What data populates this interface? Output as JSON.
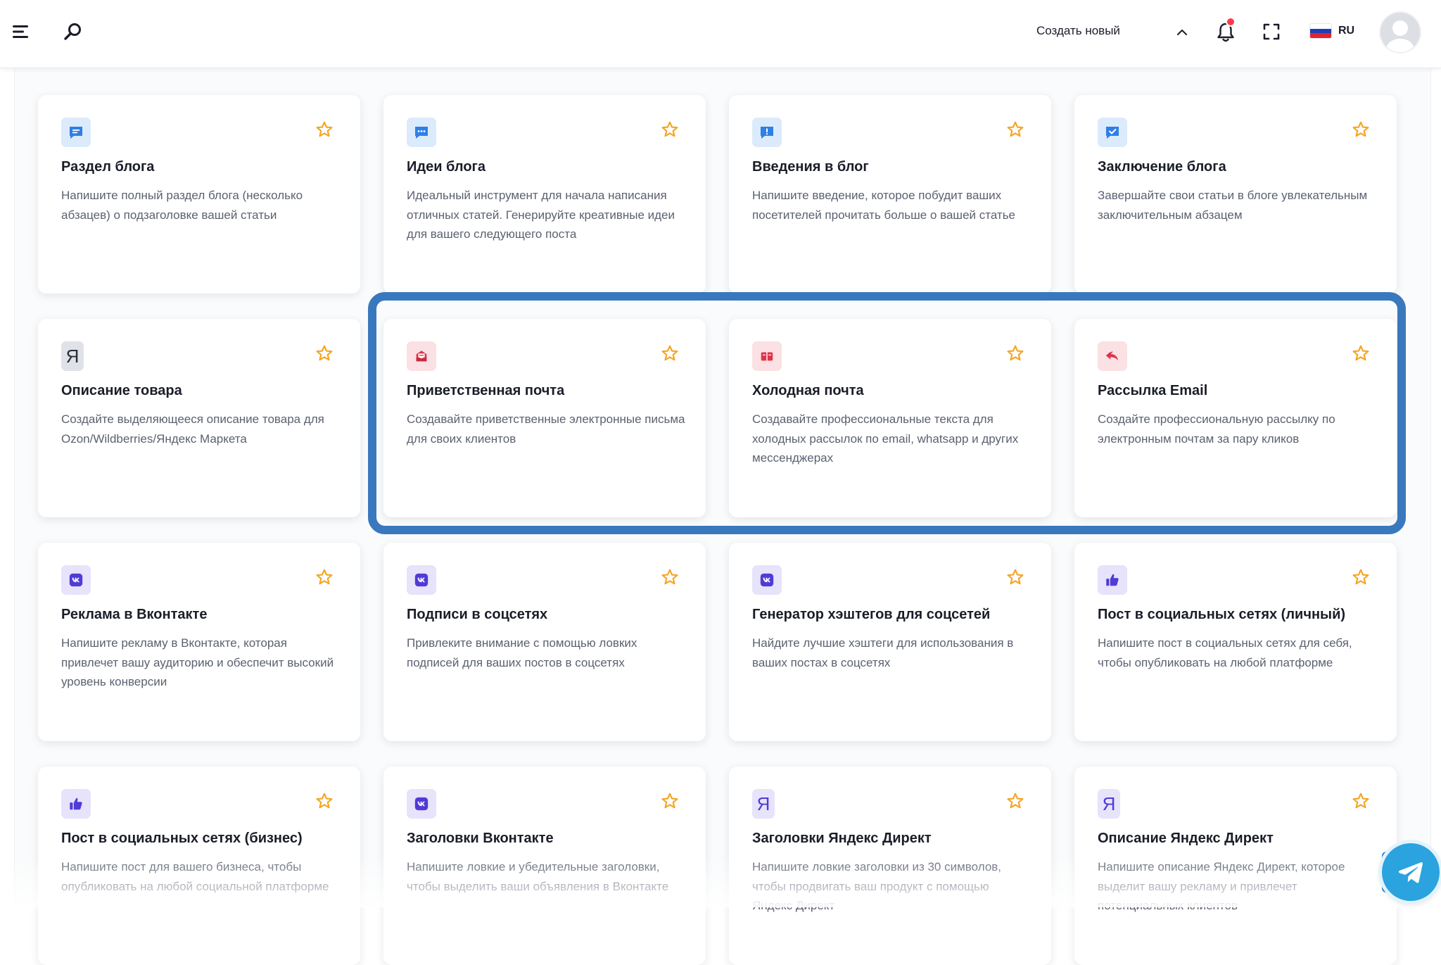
{
  "header": {
    "create_label": "Создать новый",
    "lang_code": "RU"
  },
  "colors": {
    "accent": "#3a78be",
    "star": "#f5a524",
    "notification": "#ff3b4a",
    "telegram": "#2aa3df"
  },
  "cards": [
    {
      "icon": "chat-icon",
      "title": "Раздел блога",
      "desc": "Напишите полный раздел блога (несколько абзацев) о подзаголовке вашей статьи"
    },
    {
      "icon": "chat-dots-icon",
      "title": "Идеи блога",
      "desc": "Идеальный инструмент для начала написания отличных статей. Генерируйте креативные идеи для вашего следующего поста"
    },
    {
      "icon": "chat-alert-icon",
      "title": "Введения в блог",
      "desc": "Напишите введение, которое побудит ваших посетителей прочитать больше о вашей статье"
    },
    {
      "icon": "chat-check-icon",
      "title": "Заключение блога",
      "desc": "Завершайте свои статьи в блоге увлекательным заключительным абзацем"
    },
    {
      "icon": "yandex-icon",
      "icon_text": "Я",
      "title": "Описание товара",
      "desc": "Создайте выделяющееся описание товара для Ozon/Wildberries/Яндекс Маркета"
    },
    {
      "icon": "mail-inbox-icon",
      "title": "Приветственная почта",
      "desc": "Создавайте приветственные электронные письма для своих клиентов"
    },
    {
      "icon": "mail-open-icon",
      "title": "Холодная почта",
      "desc": "Создавайте профессиональные текста для холодных рассылок по email, whatsapp и других мессенджерах"
    },
    {
      "icon": "reply-all-icon",
      "title": "Рассылка Email",
      "desc": "Создайте профессиональную рассылку по электронным почтам за пару кликов"
    },
    {
      "icon": "vk-icon",
      "title": "Реклама в Вконтакте",
      "desc": "Напишите рекламу в Вконтакте, которая привлечет вашу аудиторию и обеспечит высокий уровень конверсии"
    },
    {
      "icon": "vk-icon",
      "title": "Подписи в соцсетях",
      "desc": "Привлеките внимание с помощью ловких подписей для ваших постов в соцсетях"
    },
    {
      "icon": "vk-icon",
      "title": "Генератор хэштегов для соцсетей",
      "desc": "Найдите лучшие хэштеги для использования в ваших постах в соцсетях"
    },
    {
      "icon": "thumbs-up-icon",
      "title": "Пост в социальных сетях (личный)",
      "desc": "Напишите пост в социальных сетях для себя, чтобы опубликовать на любой платформе"
    },
    {
      "icon": "thumbs-up-icon",
      "title": "Пост в социальных сетях (бизнес)",
      "desc": "Напишите пост для вашего бизнеса, чтобы опубликовать на любой социальной платформе"
    },
    {
      "icon": "vk-icon",
      "title": "Заголовки Вконтакте",
      "desc": "Напишите ловкие и убедительные заголовки, чтобы выделить ваши объявления в Вконтакте"
    },
    {
      "icon": "yandex-icon",
      "icon_text": "Я",
      "title": "Заголовки Яндекс Директ",
      "desc": "Напишите ловкие заголовки из 30 символов, чтобы продвигать ваш продукт с помощью Яндекс Директ"
    },
    {
      "icon": "yandex-icon",
      "icon_text": "Я",
      "title": "Описание Яндекс Директ",
      "desc": "Напишите описание Яндекс Директ, которое выделит вашу рекламу и привлечет потенциальных клиентов"
    }
  ]
}
